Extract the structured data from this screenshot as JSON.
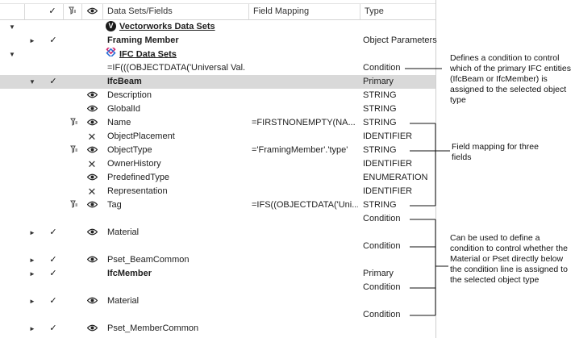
{
  "header": {
    "datasets_fields": "Data Sets/Fields",
    "field_mapping": "Field Mapping",
    "type": "Type"
  },
  "rows": [
    {
      "name": "Vectorworks Data Sets",
      "mapping": "",
      "type": ""
    },
    {
      "name": "Framing Member",
      "mapping": "",
      "type": "Object Parameters"
    },
    {
      "name": "IFC Data Sets",
      "mapping": "",
      "type": ""
    },
    {
      "name": "=IF(((OBJECTDATA('Universal Val...",
      "mapping": "",
      "type": "Condition"
    },
    {
      "name": "IfcBeam",
      "mapping": "",
      "type": "Primary"
    },
    {
      "name": "Description",
      "mapping": "",
      "type": "STRING"
    },
    {
      "name": "GlobalId",
      "mapping": "",
      "type": "STRING"
    },
    {
      "name": "Name",
      "mapping": "=FIRSTNONEMPTY(NA...",
      "type": "STRING"
    },
    {
      "name": "ObjectPlacement",
      "mapping": "",
      "type": "IDENTIFIER"
    },
    {
      "name": "ObjectType",
      "mapping": "='FramingMember'.'type'",
      "type": "STRING"
    },
    {
      "name": "OwnerHistory",
      "mapping": "",
      "type": "IDENTIFIER"
    },
    {
      "name": "PredefinedType",
      "mapping": "",
      "type": "ENUMERATION"
    },
    {
      "name": "Representation",
      "mapping": "",
      "type": "IDENTIFIER"
    },
    {
      "name": "Tag",
      "mapping": "=IFS((OBJECTDATA('Uni...",
      "type": "STRING"
    },
    {
      "name": "",
      "mapping": "",
      "type": "Condition"
    },
    {
      "name": "Material",
      "mapping": "",
      "type": ""
    },
    {
      "name": "",
      "mapping": "",
      "type": "Condition"
    },
    {
      "name": "Pset_BeamCommon",
      "mapping": "",
      "type": ""
    },
    {
      "name": "IfcMember",
      "mapping": "",
      "type": "Primary"
    },
    {
      "name": "",
      "mapping": "",
      "type": "Condition"
    },
    {
      "name": "Material",
      "mapping": "",
      "type": ""
    },
    {
      "name": "",
      "mapping": "",
      "type": "Condition"
    },
    {
      "name": "Pset_MemberCommon",
      "mapping": "",
      "type": ""
    }
  ],
  "annotations": {
    "condition_note": "Defines a condition to control which of the primary IFC entities (IfcBeam or IfcMember) is assigned to the selected object type",
    "mapping_note": "Field mapping for three fields",
    "material_note": "Can be used to define a condition to control whether the Material or Pset directly below the condition line is assigned to the selected object type"
  },
  "icons": {
    "expanded": "triangle-down-icon",
    "collapsed": "triangle-right-icon",
    "check": "check-icon",
    "visible": "eye-icon",
    "excluded": "x-icon",
    "mapped": "funnel-icon",
    "vectorworks": "vectorworks-logo-icon",
    "ifc": "ifc-logo-icon"
  },
  "colors": {
    "selected_row": "#d9d9d9",
    "grid_line": "#d9d9d9",
    "text": "#1e1e1e"
  }
}
